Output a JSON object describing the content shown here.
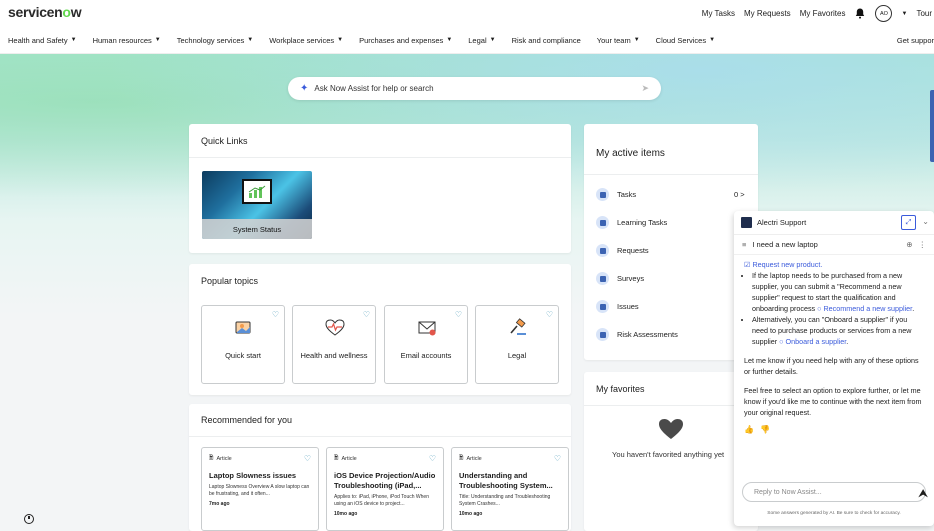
{
  "brand": {
    "logo_text_a": "servicen",
    "logo_text_o": "o",
    "logo_text_b": "w"
  },
  "top_links": {
    "tasks": "My Tasks",
    "requests": "My Requests",
    "favorites": "My Favorites",
    "avatar": "AO",
    "tour": "Tour"
  },
  "nav": {
    "items": [
      "Health and Safety",
      "Human resources",
      "Technology services",
      "Workplace services",
      "Purchases and expenses",
      "Legal",
      "Risk and compliance",
      "Your team",
      "Cloud Services"
    ],
    "right": "Get suppor"
  },
  "search": {
    "placeholder": "Ask Now Assist for help or search"
  },
  "quick_links": {
    "title": "Quick Links",
    "tile_label": "System Status"
  },
  "popular": {
    "title": "Popular topics",
    "topics": [
      "Quick start",
      "Health and wellness",
      "Email accounts",
      "Legal"
    ]
  },
  "recommended": {
    "title": "Recommended for you",
    "articles": [
      {
        "tag": "Article",
        "title": "Laptop Slowness issues",
        "desc": "Laptop Slowness Overview A slow laptop can be frustrating, and it often...",
        "age": "7mo ago"
      },
      {
        "tag": "Article",
        "title": "iOS Device Projection/Audio Troubleshooting (iPad,...",
        "desc": "Applies to: iPad, iPhone, iPod Touch When using an iOS device to project...",
        "age": "10mo ago"
      },
      {
        "tag": "Article",
        "title": "Understanding and Troubleshooting System...",
        "desc": "Title: Understanding and Troubleshooting System Crashes...",
        "age": "10mo ago"
      }
    ]
  },
  "active_items": {
    "title": "My active items",
    "rows": [
      "Tasks",
      "Learning Tasks",
      "Requests",
      "Surveys",
      "Issues",
      "Risk Assessments"
    ],
    "tasks_count": "0 >"
  },
  "favorites": {
    "title": "My favorites",
    "empty": "You haven't favorited anything yet"
  },
  "chat": {
    "title": "Alectri Support",
    "thread": "I need a new laptop",
    "request_link": "Request new product.",
    "bullet1_text": "If the laptop needs to be purchased from a new supplier, you can submit a \"Recommend a new supplier\" request to start the qualification and onboarding process ",
    "bullet1_link": "Recommend a new supplier",
    "bullet2_text": "Alternatively, you can \"Onboard a supplier\" if you need to purchase products or services from a new supplier ",
    "bullet2_link": "Onboard a supplier",
    "para1": "Let me know if you need help with any of these options or further details.",
    "para2": "Feel free to select an option to explore further, or let me know if you'd like me to continue with the next item from your original request.",
    "reply_placeholder": "Reply to Now Assist...",
    "footer": "Some answers generated by AI. Be sure to check for accuracy."
  }
}
